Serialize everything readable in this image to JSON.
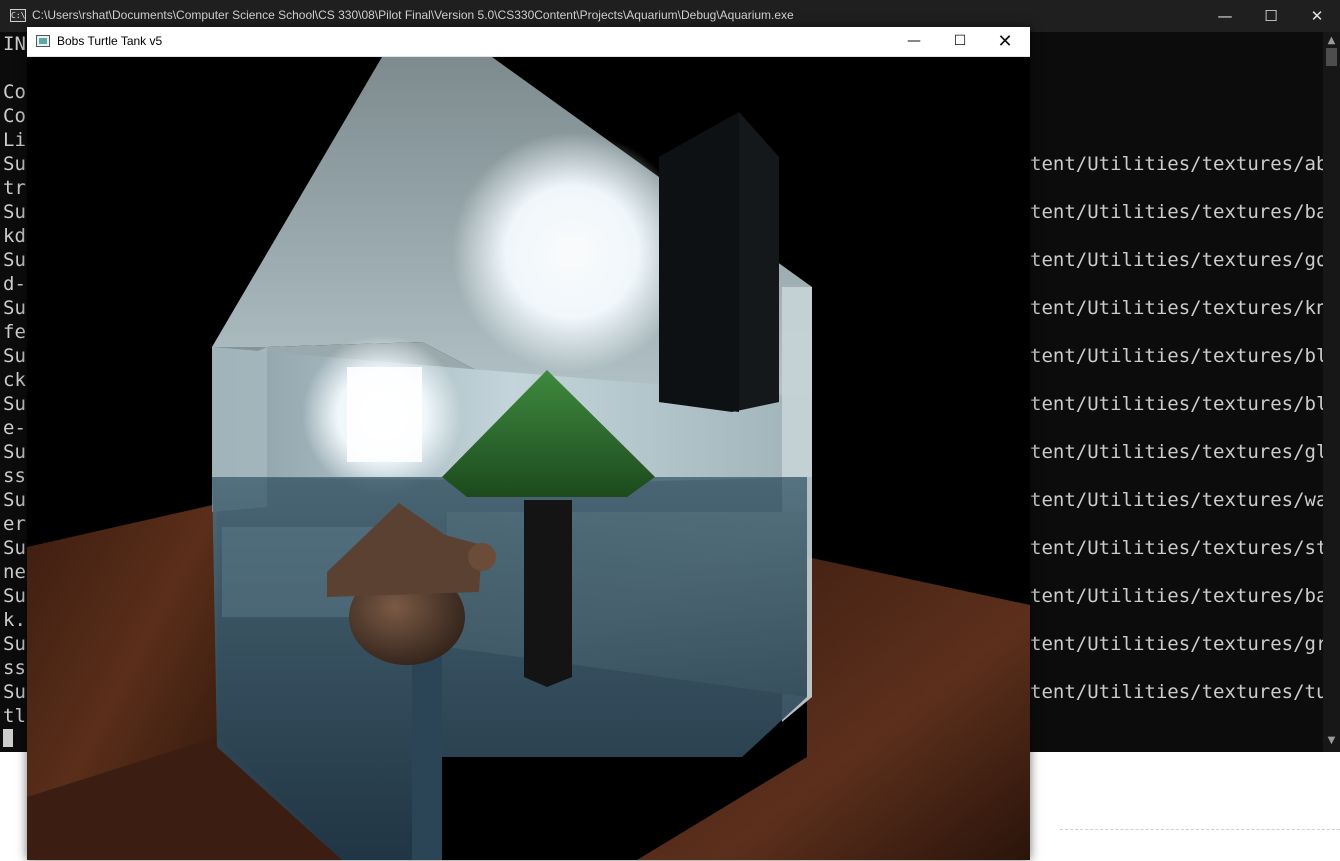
{
  "console": {
    "title": "C:\\Users\\rshat\\Documents\\Computer Science School\\CS 330\\08\\Pilot Final\\Version 5.0\\CS330Content\\Projects\\Aquarium\\Debug\\Aquarium.exe",
    "icon_label": "C:\\",
    "left_fragments": [
      "IN",
      "",
      "Cor",
      "Cor",
      "Li",
      "Su",
      "tr",
      "Su",
      "kd",
      "Su",
      "d-",
      "Su",
      "fe",
      "Su",
      "ck",
      "Su",
      "e-",
      "Su",
      "ss",
      "Su",
      "er",
      "Su",
      "ne",
      "Su",
      "k.",
      "Su",
      "ss",
      "Su",
      "tl"
    ],
    "right_fragments": [
      "tent/Utilities/textures/abs",
      "tent/Utilities/textures/bac",
      "tent/Utilities/textures/gol",
      "tent/Utilities/textures/kni",
      "tent/Utilities/textures/bla",
      "tent/Utilities/textures/blu",
      "tent/Utilities/textures/gla",
      "tent/Utilities/textures/wat",
      "tent/Utilities/textures/sto",
      "tent/Utilities/textures/bar",
      "tent/Utilities/textures/gra",
      "tent/Utilities/textures/tur"
    ],
    "window_controls": {
      "minimize": "—",
      "maximize": "☐",
      "close": "✕"
    },
    "scrollbar": {
      "up": "▲",
      "down": "▼"
    }
  },
  "game": {
    "title": "Bobs Turtle Tank v5",
    "window_controls": {
      "minimize": "—",
      "maximize": "☐",
      "close": "✕"
    },
    "colors": {
      "table_wood": "#4a2516",
      "tank_glass": "#a7b9bf",
      "water": "#2d4554",
      "cone": "#2d6a2d",
      "wood_post": "#1a1a1a",
      "light_glow": "#ffffff",
      "rock": "#4c3527",
      "sand": "#8a8f7a"
    }
  }
}
